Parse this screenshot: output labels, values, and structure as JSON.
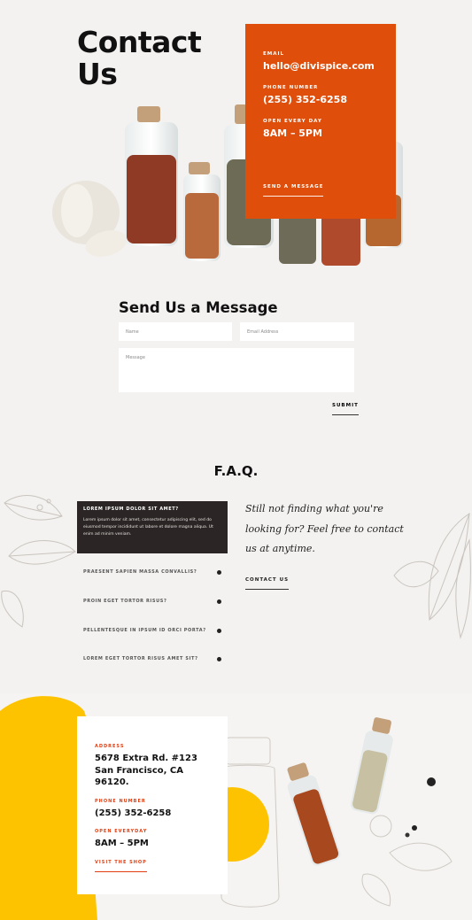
{
  "hero": {
    "title": "Contact Us"
  },
  "contact_card": {
    "email_label": "EMAIL",
    "email": "hello@divispice.com",
    "phone_label": "PHONE NUMBER",
    "phone": "(255) 352-6258",
    "hours_label": "OPEN EVERY DAY",
    "hours": "8AM – 5PM",
    "cta": "SEND A MESSAGE"
  },
  "form": {
    "title": "Send Us a Message",
    "name_placeholder": "Name",
    "email_placeholder": "Email Address",
    "message_placeholder": "Message",
    "submit": "SUBMIT"
  },
  "faq": {
    "title": "F.A.Q.",
    "open_question": "LOREM IPSUM DOLOR SIT AMET?",
    "open_answer": "Lorem ipsum dolor sit amet, consectetur adipiscing elit, sed do eiusmod tempor incididunt ut labore et dolore magna aliqua. Ut enim ad minim veniam.",
    "items": [
      {
        "question": "PRAESENT SAPIEN MASSA CONVALLIS?"
      },
      {
        "question": "PROIN EGET TORTOR RISUS?"
      },
      {
        "question": "PELLENTESQUE IN IPSUM ID ORCI PORTA?"
      },
      {
        "question": "LOREM EGET TORTOR RISUS AMET SIT?"
      }
    ],
    "side_text": "Still not finding what you're looking for? Feel free to contact us at anytime.",
    "side_cta": "CONTACT US"
  },
  "address_card": {
    "address_label": "ADDRESS",
    "address": "5678 Extra Rd. #123 San Francisco, CA 96120.",
    "phone_label": "PHONE NUMBER",
    "phone": "(255) 352-6258",
    "hours_label": "OPEN EVERYDAY",
    "hours": "8AM – 5PM",
    "cta": "VISIT THE SHOP"
  },
  "colors": {
    "accent": "#e04e0b",
    "yellow": "#fec300",
    "dark": "#2b2625"
  },
  "icons": [
    "faq-toggle-icon"
  ]
}
